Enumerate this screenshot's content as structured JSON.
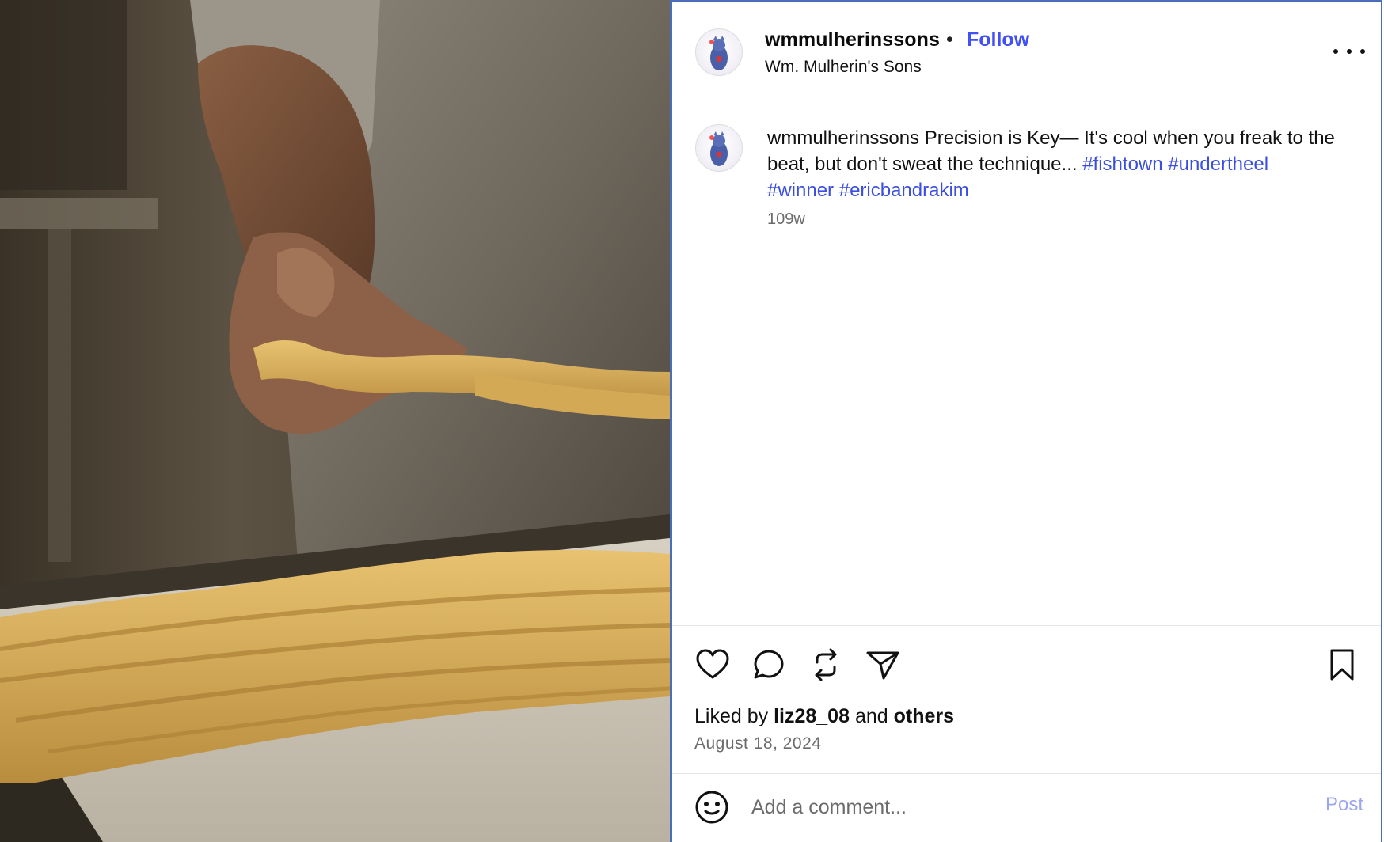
{
  "post": {
    "username": "wmmulherinssons",
    "display_name": "Wm. Mulherin's Sons",
    "follow_label": "Follow",
    "separator": "•",
    "caption_username": "wmmulherinssons",
    "caption_body": "Precision is Key— It's cool when you freak to the beat, but don't sweat the technique...",
    "hashtags": [
      "#fishtown",
      "#undertheel",
      "#winner",
      "#ericbandrakim"
    ],
    "time_ago": "109w"
  },
  "engagement": {
    "liked_by_prefix": "Liked by",
    "liked_by_user": "liz28_08",
    "liked_by_and": "and",
    "liked_by_others": "others",
    "date": "August 18, 2024"
  },
  "comment": {
    "placeholder": "Add a comment...",
    "post_label": "Post"
  },
  "icons": {
    "more": "more-options-icon",
    "like": "heart-icon",
    "comment": "comment-bubble-icon",
    "repost": "repost-icon",
    "share": "send-icon",
    "save": "bookmark-icon",
    "emoji": "emoji-icon"
  },
  "colors": {
    "accent": "#4150f7",
    "hashtag": "#3a4ee0",
    "post_disabled": "#9aa6f0",
    "panel_border": "#4a6fb8"
  }
}
